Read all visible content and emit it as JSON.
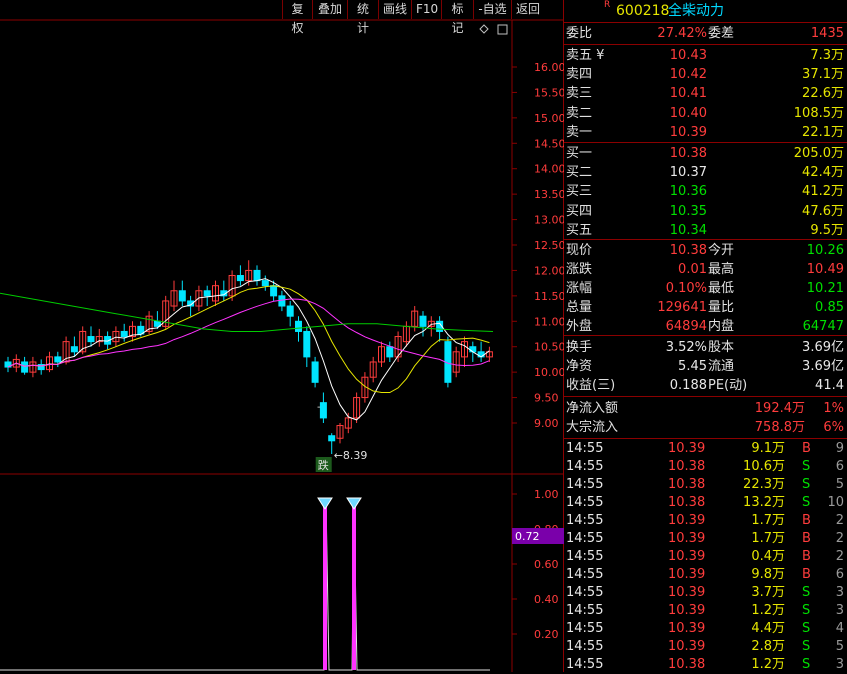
{
  "toolbar": [
    "复权",
    "叠加",
    "统计",
    "画线",
    "F10",
    "标记",
    "-自选",
    "返回"
  ],
  "stock": {
    "badge": "R",
    "code": "600218",
    "name": "全柴动力"
  },
  "order_ratio": {
    "label_ratio": "委比",
    "ratio": "27.42%",
    "label_diff": "委差",
    "diff": "1435"
  },
  "asks": [
    {
      "label": "卖五 ¥",
      "price": "10.43",
      "vol": "7.3万"
    },
    {
      "label": "卖四",
      "price": "10.42",
      "vol": "37.1万"
    },
    {
      "label": "卖三",
      "price": "10.41",
      "vol": "22.6万"
    },
    {
      "label": "卖二",
      "price": "10.40",
      "vol": "108.5万"
    },
    {
      "label": "卖一",
      "price": "10.39",
      "vol": "22.1万"
    }
  ],
  "bids": [
    {
      "label": "买一",
      "price": "10.38",
      "vol": "205.0万"
    },
    {
      "label": "买二",
      "price": "10.37",
      "vol": "42.4万"
    },
    {
      "label": "买三",
      "price": "10.36",
      "vol": "41.2万"
    },
    {
      "label": "买四",
      "price": "10.35",
      "vol": "47.6万"
    },
    {
      "label": "买五",
      "price": "10.34",
      "vol": "9.5万"
    }
  ],
  "quote": [
    {
      "l1": "现价",
      "v1": "10.38",
      "l2": "今开",
      "v2": "10.26"
    },
    {
      "l1": "涨跌",
      "v1": "0.01",
      "l2": "最高",
      "v2": "10.49"
    },
    {
      "l1": "涨幅",
      "v1": "0.10%",
      "l2": "最低",
      "v2": "10.21"
    },
    {
      "l1": "总量",
      "v1": "129641",
      "l2": "量比",
      "v2": "0.85"
    },
    {
      "l1": "外盘",
      "v1": "64894",
      "l2": "内盘",
      "v2": "64747"
    }
  ],
  "fundamentals": [
    {
      "l1": "换手",
      "v1": "3.52%",
      "l2": "股本",
      "v2": "3.69亿"
    },
    {
      "l1": "净资",
      "v1": "5.45",
      "l2": "流通",
      "v2": "3.69亿"
    },
    {
      "l1": "收益(三)",
      "v1": "0.188",
      "l2": "PE(动)",
      "v2": "41.4"
    }
  ],
  "flows": [
    {
      "label": "净流入额",
      "value": "192.4万",
      "pct": "1%"
    },
    {
      "label": "大宗流入",
      "value": "758.8万",
      "pct": "6%"
    }
  ],
  "ticks": [
    {
      "time": "14:55",
      "price": "10.39",
      "vol": "9.1万",
      "side": "B",
      "n": "9"
    },
    {
      "time": "14:55",
      "price": "10.38",
      "vol": "10.6万",
      "side": "S",
      "n": "6"
    },
    {
      "time": "14:55",
      "price": "10.38",
      "vol": "22.3万",
      "side": "S",
      "n": "5"
    },
    {
      "time": "14:55",
      "price": "10.38",
      "vol": "13.2万",
      "side": "S",
      "n": "10"
    },
    {
      "time": "14:55",
      "price": "10.39",
      "vol": "1.7万",
      "side": "B",
      "n": "2"
    },
    {
      "time": "14:55",
      "price": "10.39",
      "vol": "1.7万",
      "side": "B",
      "n": "2"
    },
    {
      "time": "14:55",
      "price": "10.39",
      "vol": "0.4万",
      "side": "B",
      "n": "2"
    },
    {
      "time": "14:55",
      "price": "10.39",
      "vol": "9.8万",
      "side": "B",
      "n": "6"
    },
    {
      "time": "14:55",
      "price": "10.39",
      "vol": "3.7万",
      "side": "S",
      "n": "3"
    },
    {
      "time": "14:55",
      "price": "10.39",
      "vol": "1.2万",
      "side": "S",
      "n": "3"
    },
    {
      "time": "14:55",
      "price": "10.39",
      "vol": "4.4万",
      "side": "S",
      "n": "4"
    },
    {
      "time": "14:55",
      "price": "10.39",
      "vol": "2.8万",
      "side": "S",
      "n": "5"
    },
    {
      "time": "14:55",
      "price": "10.38",
      "vol": "1.2万",
      "side": "S",
      "n": "3"
    }
  ],
  "price_axis": [
    "16.00",
    "15.50",
    "15.00",
    "14.50",
    "14.00",
    "13.50",
    "13.00",
    "12.50",
    "12.00",
    "11.50",
    "11.00",
    "10.50",
    "10.00",
    "9.50",
    "9.00"
  ],
  "indicator_axis": [
    "1.00",
    "0.80",
    "0.60",
    "0.40",
    "0.20"
  ],
  "indicator_value": "0.72",
  "low_marker": {
    "text": "8.39",
    "badge": "跌"
  },
  "colors": {
    "up": "#ff3c3c",
    "down": "#00e5ff",
    "ma5": "#ffffff",
    "ma10": "#e6e600",
    "ma20": "#ff33ff",
    "ma60": "#00cc00",
    "indicator": "#ff33ff",
    "frame": "#8b0000"
  }
}
